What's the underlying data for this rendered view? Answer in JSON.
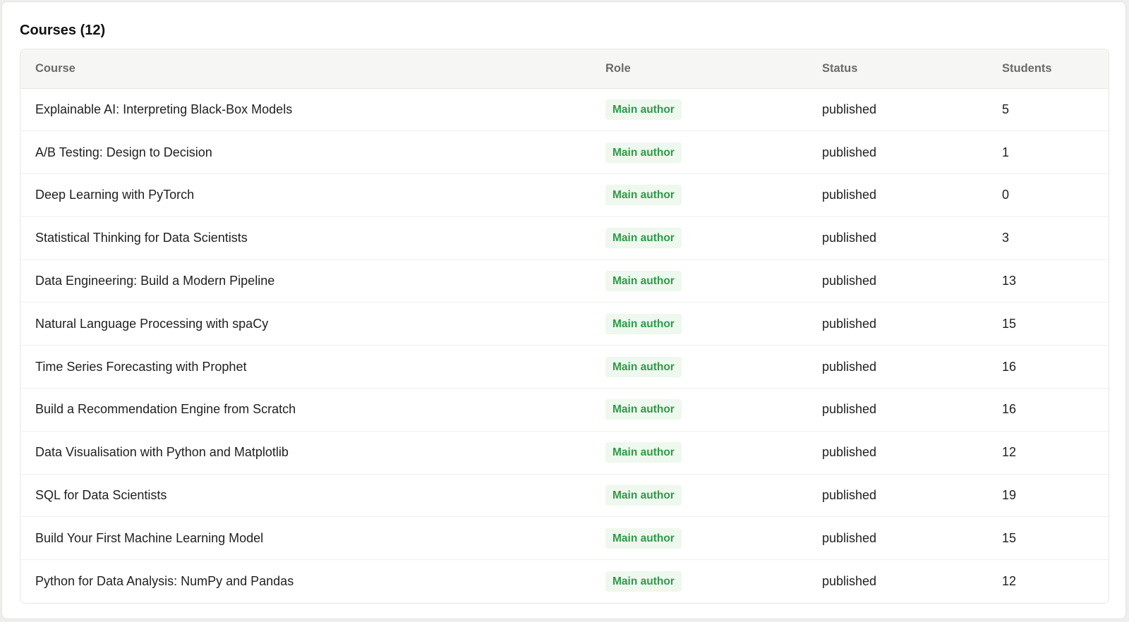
{
  "section": {
    "title": "Courses (12)"
  },
  "table": {
    "headers": {
      "course": "Course",
      "role": "Role",
      "status": "Status",
      "students": "Students"
    },
    "rows": [
      {
        "course": "Explainable AI: Interpreting Black-Box Models",
        "role": "Main author",
        "status": "published",
        "students": "5"
      },
      {
        "course": "A/B Testing: Design to Decision",
        "role": "Main author",
        "status": "published",
        "students": "1"
      },
      {
        "course": "Deep Learning with PyTorch",
        "role": "Main author",
        "status": "published",
        "students": "0"
      },
      {
        "course": "Statistical Thinking for Data Scientists",
        "role": "Main author",
        "status": "published",
        "students": "3"
      },
      {
        "course": "Data Engineering: Build a Modern Pipeline",
        "role": "Main author",
        "status": "published",
        "students": "13"
      },
      {
        "course": "Natural Language Processing with spaCy",
        "role": "Main author",
        "status": "published",
        "students": "15"
      },
      {
        "course": "Time Series Forecasting with Prophet",
        "role": "Main author",
        "status": "published",
        "students": "16"
      },
      {
        "course": "Build a Recommendation Engine from Scratch",
        "role": "Main author",
        "status": "published",
        "students": "16"
      },
      {
        "course": "Data Visualisation with Python and Matplotlib",
        "role": "Main author",
        "status": "published",
        "students": "12"
      },
      {
        "course": "SQL for Data Scientists",
        "role": "Main author",
        "status": "published",
        "students": "19"
      },
      {
        "course": "Build Your First Machine Learning Model",
        "role": "Main author",
        "status": "published",
        "students": "15"
      },
      {
        "course": "Python for Data Analysis: NumPy and Pandas",
        "role": "Main author",
        "status": "published",
        "students": "12"
      }
    ]
  },
  "colors": {
    "badge_text": "#2f9a48",
    "badge_background": "#eef8ee",
    "header_background": "#f6f6f4"
  }
}
